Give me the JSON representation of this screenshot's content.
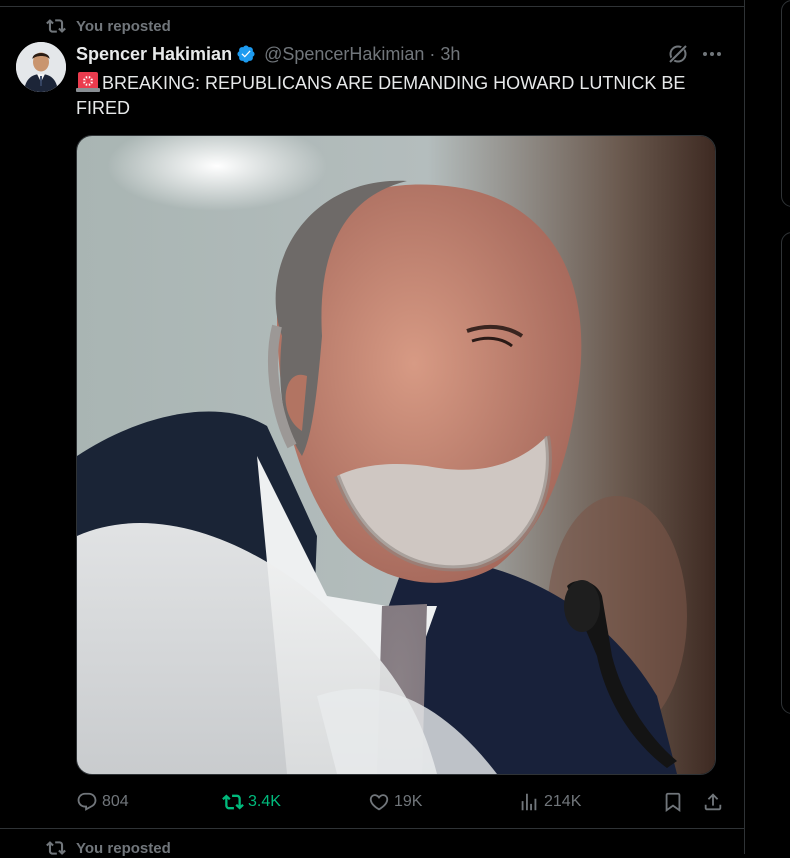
{
  "repost_context": {
    "label": "You reposted"
  },
  "tweet": {
    "author_name": "Spencer Hakimian",
    "handle": "@SpencerHakimian",
    "separator": "·",
    "time": "3h",
    "text": "BREAKING: REPUBLICANS ARE DEMANDING HOWARD LUTNICK BE FIRED",
    "text_prefix_emoji": "rotating-light-icon",
    "verified": true,
    "accent_color": "#1d9bf0"
  },
  "metrics": {
    "replies": "804",
    "reposts": "3.4K",
    "likes": "19K",
    "views": "214K"
  },
  "next_repost_context": {
    "label": "You reposted"
  },
  "colors": {
    "background": "#000000",
    "text": "#e7e9ea",
    "muted": "#71767b",
    "border": "#2f3336",
    "repost_green": "#00ba7c",
    "verified_blue": "#1d9bf0"
  }
}
